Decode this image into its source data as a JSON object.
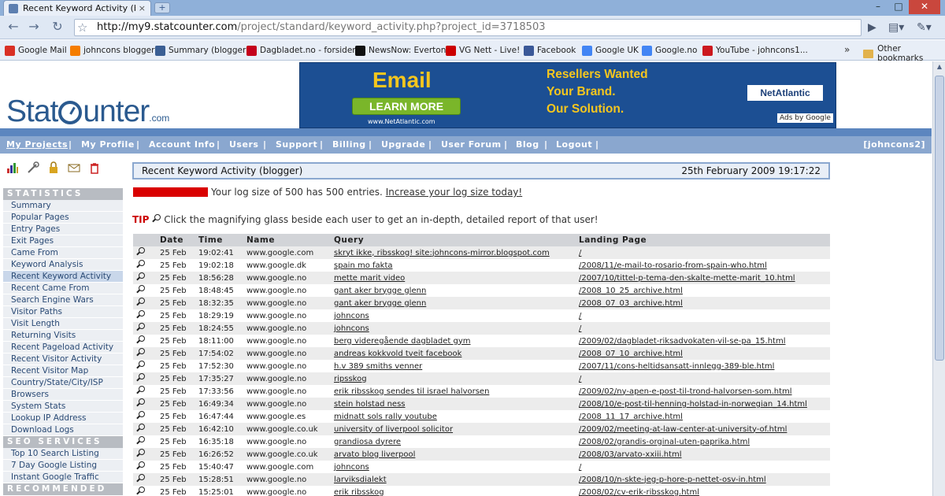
{
  "browser": {
    "tab_title": "Recent Keyword Activity (b...",
    "tab_close": "×",
    "new_tab": "+",
    "window_buttons": [
      "–",
      "□",
      "✕"
    ],
    "url_host": "http://my9.statcounter.com",
    "url_path": "/project/standard/keyword_activity.php?project_id=3718503",
    "bookmarks": [
      {
        "label": "Google Mail",
        "icon": "gmail-icon",
        "color": "#d93025"
      },
      {
        "label": "johncons blogger",
        "icon": "blogger-icon",
        "color": "#f57d00"
      },
      {
        "label": "Summary (blogger)",
        "icon": "statcounter-icon",
        "color": "#3b5f94"
      },
      {
        "label": "Dagbladet.no - forsiden",
        "icon": "dagbladet-icon",
        "color": "#c4001b"
      },
      {
        "label": "NewsNow: Everton",
        "icon": "newsnow-icon",
        "color": "#111111"
      },
      {
        "label": "VG Nett - Live!",
        "icon": "vg-icon",
        "color": "#cc0000"
      },
      {
        "label": "Facebook",
        "icon": "facebook-icon",
        "color": "#3b5998"
      },
      {
        "label": "Google UK",
        "icon": "google-icon",
        "color": "#4285f4"
      },
      {
        "label": "Google.no",
        "icon": "google-icon",
        "color": "#4285f4"
      },
      {
        "label": "YouTube - johncons1...",
        "icon": "youtube-icon",
        "color": "#cc181e"
      }
    ],
    "bookmarks_more": "»",
    "other_bookmarks": "Other bookmarks"
  },
  "ad": {
    "headline": "Email",
    "button": "LEARN MORE",
    "url": "www.NetAtlantic.com",
    "tagline": [
      "Resellers Wanted",
      "Your Brand.",
      "Our Solution."
    ],
    "brand": "NetAtlantic",
    "ads_by": "Ads by Google"
  },
  "logo": {
    "text_a": "Stat",
    "text_b": "unter",
    "suffix": ".com"
  },
  "menu": {
    "items": [
      "My Projects",
      "My Profile",
      "Account Info",
      "Users",
      "Support",
      "Billing",
      "Upgrade",
      "User Forum",
      "Blog",
      "Logout"
    ],
    "separator": "|",
    "user": "[johncons2]"
  },
  "sidebar": {
    "sections": [
      {
        "title": "STATISTICS",
        "items": [
          "Summary",
          "Popular Pages",
          "Entry Pages",
          "Exit Pages",
          "Came From",
          "Keyword Analysis",
          "Recent Keyword Activity",
          "Recent Came From",
          "Search Engine Wars",
          "Visitor Paths",
          "Visit Length",
          "Returning Visits",
          "Recent Pageload Activity",
          "Recent Visitor Activity",
          "Recent Visitor Map",
          "Country/State/City/ISP",
          "Browsers",
          "System Stats",
          "Lookup IP Address",
          "Download Logs"
        ]
      },
      {
        "title": "SEO SERVICES",
        "items": [
          "Top 10 Search Listing",
          "7 Day Google Listing",
          "Instant Google Traffic"
        ]
      },
      {
        "title": "RECOMMENDED",
        "items": []
      }
    ],
    "active_item": "Recent Keyword Activity"
  },
  "report": {
    "title": "Recent Keyword Activity (blogger)",
    "timestamp": "25th February 2009 19:17:22",
    "log_text": "Your log size of 500 has 500 entries.",
    "log_link": "Increase your log size today!",
    "tip_label": "TIP",
    "tip_text": "Click the magnifying glass beside each user to get an in-depth, detailed report of that user!",
    "columns": [
      "Date",
      "Time",
      "Name",
      "Query",
      "Landing Page"
    ],
    "rows": [
      [
        "25 Feb",
        "19:02:41",
        "www.google.com",
        "skryt ikke, ribsskog! site:johncons-mirror.blogspot.com",
        "/"
      ],
      [
        "25 Feb",
        "19:02:18",
        "www.google.dk",
        "spain mo fakta",
        "/2008/11/e-mail-to-rosario-from-spain-who.html"
      ],
      [
        "25 Feb",
        "18:56:28",
        "www.google.no",
        "mette marit video",
        "/2007/10/tittel-p-tema-den-skalte-mette-marit_10.html"
      ],
      [
        "25 Feb",
        "18:48:45",
        "www.google.no",
        "gant aker brygge glenn",
        "/2008_10_25_archive.html"
      ],
      [
        "25 Feb",
        "18:32:35",
        "www.google.no",
        "gant aker brygge glenn",
        "/2008_07_03_archive.html"
      ],
      [
        "25 Feb",
        "18:29:19",
        "www.google.no",
        "johncons",
        "/"
      ],
      [
        "25 Feb",
        "18:24:55",
        "www.google.no",
        "johncons",
        "/"
      ],
      [
        "25 Feb",
        "18:11:00",
        "www.google.no",
        "berg videregående dagbladet gym",
        "/2009/02/dagbladet-riksadvokaten-vil-se-pa_15.html"
      ],
      [
        "25 Feb",
        "17:54:02",
        "www.google.no",
        "andreas kokkvold tveit facebook",
        "/2008_07_10_archive.html"
      ],
      [
        "25 Feb",
        "17:52:30",
        "www.google.no",
        "h.v 389 smiths venner",
        "/2007/11/cons-heltidsansatt-innlegg-389-ble.html"
      ],
      [
        "25 Feb",
        "17:35:27",
        "www.google.no",
        "ripsskog",
        "/"
      ],
      [
        "25 Feb",
        "17:33:56",
        "www.google.no",
        "erik ribsskog sendes til israel halvorsen",
        "/2009/02/ny-apen-e-post-til-trond-halvorsen-som.html"
      ],
      [
        "25 Feb",
        "16:49:34",
        "www.google.no",
        "stein holstad ness",
        "/2008/10/e-post-til-henning-holstad-in-norwegian_14.html"
      ],
      [
        "25 Feb",
        "16:47:44",
        "www.google.es",
        "midnatt sols rally youtube",
        "/2008_11_17_archive.html"
      ],
      [
        "25 Feb",
        "16:42:10",
        "www.google.co.uk",
        "university of liverpool solicitor",
        "/2009/02/meeting-at-law-center-at-university-of.html"
      ],
      [
        "25 Feb",
        "16:35:18",
        "www.google.no",
        "grandiosa dyrere",
        "/2008/02/grandis-orginal-uten-paprika.html"
      ],
      [
        "25 Feb",
        "16:26:52",
        "www.google.co.uk",
        "arvato blog liverpool",
        "/2008/03/arvato-xxiii.html"
      ],
      [
        "25 Feb",
        "15:40:47",
        "www.google.com",
        "johncons",
        "/"
      ],
      [
        "25 Feb",
        "15:28:51",
        "www.google.no",
        "larviksdialekt",
        "/2008/10/n-skte-jeg-p-hore-p-nettet-osv-in.html"
      ],
      [
        "25 Feb",
        "15:25:01",
        "www.google.no",
        "erik ribsskog",
        "/2008/02/cv-erik-ribsskog.html"
      ]
    ]
  },
  "colors": {
    "brand_blue": "#2b5a8f",
    "menu_bar": "#8aa7cf",
    "log_bar": "#d90000"
  }
}
